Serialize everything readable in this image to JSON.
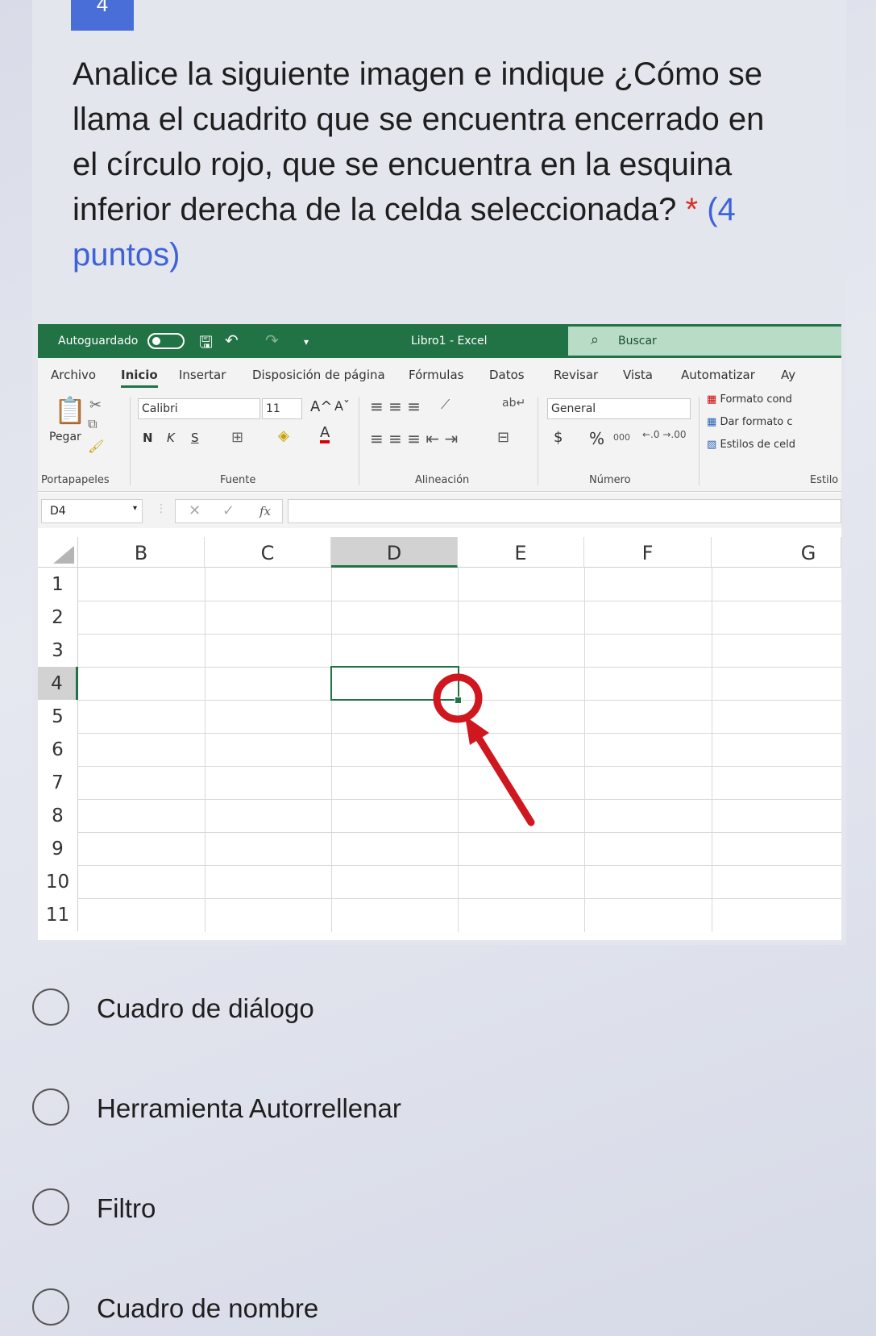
{
  "question": {
    "number": "4",
    "text": "Analice la siguiente imagen e indique ¿Cómo se llama el cuadrito que se encuentra encerrado en el círculo rojo, que se encuentra en la esquina inferior derecha de la celda seleccionada?",
    "required_mark": "*",
    "points": "(4 puntos)"
  },
  "excel": {
    "autosave_label": "Autoguardado",
    "window_title": "Libro1 - Excel",
    "search_placeholder": "Buscar",
    "menu_tabs": [
      "Archivo",
      "Inicio",
      "Insertar",
      "Disposición de página",
      "Fórmulas",
      "Datos",
      "Revisar",
      "Vista",
      "Automatizar",
      "Ay"
    ],
    "active_tab": "Inicio",
    "ribbon": {
      "paste_label": "Pegar",
      "font_name": "Calibri",
      "font_size": "11",
      "number_format": "General",
      "bold": "N",
      "italic": "K",
      "underline": "S",
      "percent": "%",
      "thousands": "000",
      "currency": "$",
      "styles": [
        "Formato cond",
        "Dar formato c",
        "Estilos de celd"
      ],
      "groups": [
        "Portapapeles",
        "Fuente",
        "Alineación",
        "Número",
        "Estilo"
      ]
    },
    "name_box": "D4",
    "fx_label": "fx",
    "columns": [
      "B",
      "C",
      "D",
      "E",
      "F",
      "G"
    ],
    "selected_column": "D",
    "rows": [
      "1",
      "2",
      "3",
      "4",
      "5",
      "6",
      "7",
      "8",
      "9",
      "10",
      "11"
    ],
    "selected_row": "4"
  },
  "options": [
    {
      "label": "Cuadro de diálogo"
    },
    {
      "label": "Herramienta Autorrellenar"
    },
    {
      "label": "Filtro"
    },
    {
      "label": "Cuadro de nombre"
    }
  ],
  "colors": {
    "excel_green": "#217346",
    "accent_blue": "#3f63d6",
    "annotation_red": "#d0161e"
  }
}
